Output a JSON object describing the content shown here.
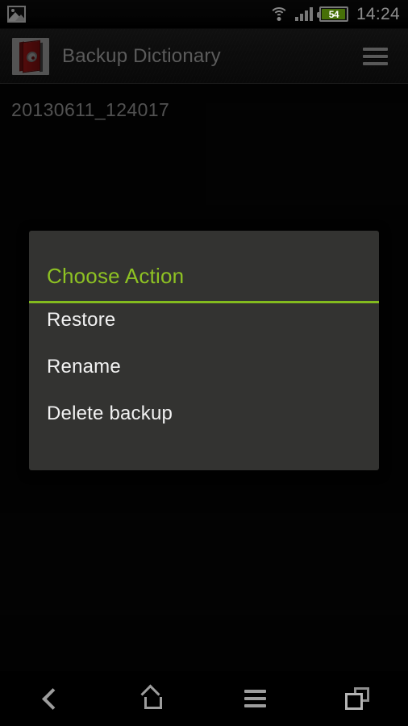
{
  "status_bar": {
    "notification_icon": "gallery-icon",
    "wifi_icon": "wifi-icon",
    "signal_icon": "cell-signal-icon",
    "battery_level": "54",
    "clock": "14:24"
  },
  "action_bar": {
    "app_icon": "backup-dictionary-app-icon",
    "title": "Backup Dictionary",
    "overflow_icon": "overflow-menu-icon"
  },
  "list": {
    "items": [
      {
        "label": "20130611_124017"
      }
    ]
  },
  "dialog": {
    "title": "Choose Action",
    "accent_color": "#8ec223",
    "background_color": "#333331",
    "options": [
      {
        "label": "Restore"
      },
      {
        "label": "Rename"
      },
      {
        "label": "Delete backup"
      }
    ]
  },
  "nav_bar": {
    "buttons": [
      {
        "name": "back",
        "icon": "back-chevron-icon"
      },
      {
        "name": "home",
        "icon": "home-icon"
      },
      {
        "name": "menu",
        "icon": "menu-icon"
      },
      {
        "name": "recents",
        "icon": "recent-apps-icon"
      }
    ]
  }
}
